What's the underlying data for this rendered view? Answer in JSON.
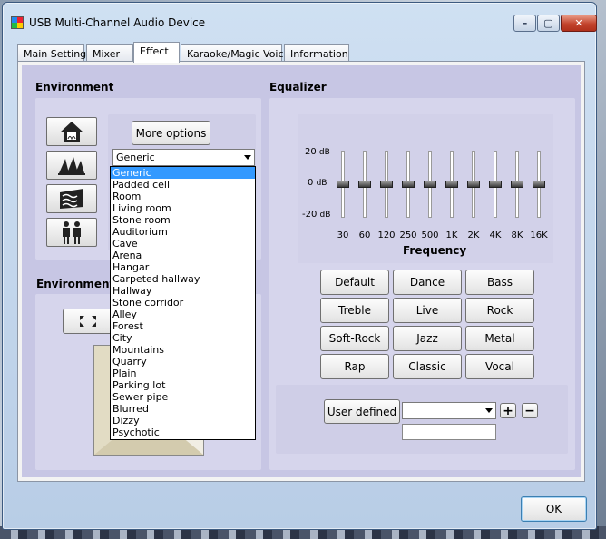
{
  "window": {
    "title": "USB Multi-Channel Audio Device"
  },
  "titlebar": {
    "min_glyph": "–",
    "max_glyph": "▢",
    "close_glyph": "✕"
  },
  "tabs": [
    {
      "label": "Main Setting"
    },
    {
      "label": "Mixer"
    },
    {
      "label": "Effect",
      "active": true
    },
    {
      "label": "Karaoke/Magic Voice"
    },
    {
      "label": "Information"
    }
  ],
  "environment": {
    "heading": "Environment",
    "more_options": "More options",
    "selected": "Generic",
    "icons": [
      "house-icon",
      "opera-house-icon",
      "water-icon",
      "people-icon"
    ],
    "options": [
      "Generic",
      "Padded cell",
      "Room",
      "Living room",
      "Stone room",
      "Auditorium",
      "Cave",
      "Arena",
      "Hangar",
      "Carpeted hallway",
      "Hallway",
      "Stone corridor",
      "Alley",
      "Forest",
      "City",
      "Mountains",
      "Quarry",
      "Plain",
      "Parking lot",
      "Sewer pipe",
      "Blurred",
      "Dizzy",
      "Psychotic"
    ]
  },
  "environment2": {
    "heading": "Environment"
  },
  "equalizer": {
    "heading": "Equalizer",
    "db_top": "20",
    "db_mid": "0",
    "db_bot": "-20",
    "db_unit": "dB",
    "frequency_label": "Frequency",
    "bands": [
      "30",
      "60",
      "120",
      "250",
      "500",
      "1K",
      "2K",
      "4K",
      "8K",
      "16K"
    ],
    "levels_db": [
      0,
      0,
      0,
      0,
      0,
      0,
      0,
      0,
      0,
      0
    ],
    "presets": [
      "Default",
      "Dance",
      "Bass",
      "Treble",
      "Live",
      "Rock",
      "Soft-Rock",
      "Jazz",
      "Metal",
      "Rap",
      "Classic",
      "Vocal"
    ],
    "user_defined": "User defined",
    "user_combo_value": "",
    "add": "+",
    "remove": "−",
    "user_text": ""
  },
  "footer": {
    "ok": "OK"
  }
}
